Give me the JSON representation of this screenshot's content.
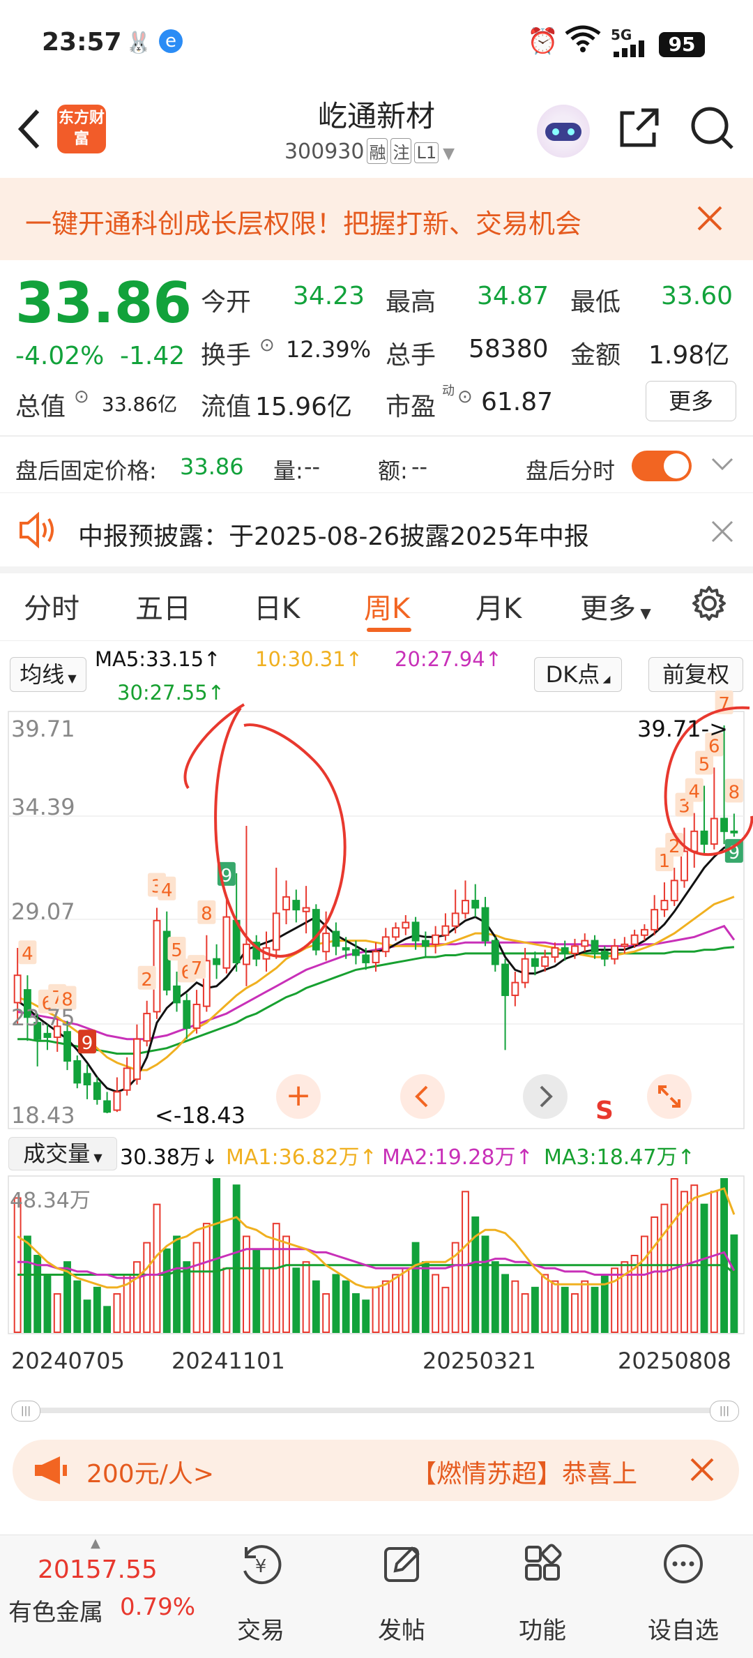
{
  "status_bar": {
    "time": "23:57",
    "network": "5G",
    "battery": "95"
  },
  "header": {
    "app_logo_text": "东方财富",
    "stock_name": "屹通新材",
    "stock_code": "300930",
    "tags": [
      "融",
      "注",
      "L1"
    ]
  },
  "banner": {
    "text": "一键开通科创成长层权限！把握打新、交易机会"
  },
  "quote": {
    "price": "33.86",
    "change_pct": "-4.02%",
    "change_amt": "-1.42",
    "open_label": "今开",
    "open": "34.23",
    "high_label": "最高",
    "high": "34.87",
    "low_label": "最低",
    "low": "33.60",
    "turnover_label": "换手",
    "turnover": "12.39%",
    "volume_label": "总手",
    "volume": "58380",
    "amount_label": "金额",
    "amount": "1.98亿",
    "mktcap_label": "总值",
    "mktcap": "33.86亿",
    "float_label": "流值",
    "float_cap": "15.96亿",
    "pe_label": "市盈",
    "pe_sup": "动",
    "pe": "61.87",
    "more_label": "更多"
  },
  "after_hours": {
    "label": "盘后固定价格:",
    "price": "33.86",
    "vol_label": "量:",
    "vol": "--",
    "amt_label": "额:",
    "amt": "--",
    "toggle_label": "盘后分时"
  },
  "notice": {
    "text": "中报预披露：于2025-08-26披露2025年中报"
  },
  "tabs": [
    "分时",
    "五日",
    "日K",
    "周K",
    "月K",
    "更多"
  ],
  "active_tab": "周K",
  "chart": {
    "indicator_label": "均线",
    "ma5": "MA5:33.15↑",
    "ma10": "10:30.31↑",
    "ma20": "20:27.94↑",
    "ma30": "30:27.55↑",
    "dk_label": "DK点",
    "adjust_label": "前复权",
    "y_labels": [
      "39.71",
      "34.39",
      "29.07",
      "23.75",
      "18.43"
    ],
    "max_marker": "39.71->",
    "min_marker": "<-18.43",
    "signal_s": "S",
    "colors": {
      "ma5": "#111111",
      "ma10": "#f0b020",
      "ma20": "#c830b8",
      "ma30": "#17a030",
      "up": "#e8382e",
      "down": "#12a23b"
    }
  },
  "volume_panel": {
    "label": "成交量",
    "vol": "30.38万↓",
    "ma1": "MA1:36.82万↑",
    "ma2": "MA2:19.28万↑",
    "ma3": "MA3:18.47万↑",
    "max_label": "48.34万",
    "dates": [
      "20240705",
      "20241101",
      "20250321",
      "20250808"
    ]
  },
  "promo": {
    "left": "200元/人>",
    "right": "【燃情苏超】恭喜上"
  },
  "bottom": {
    "index_value": "20157.55",
    "index_name": "有色金属",
    "index_pct": "0.79%",
    "nav": [
      "交易",
      "发帖",
      "功能",
      "设自选"
    ]
  },
  "chart_data": {
    "type": "candlestick",
    "period": "weekly",
    "ylim": [
      18.43,
      39.71
    ],
    "candles": [
      [
        24.5,
        26.0,
        23.3,
        27.5
      ],
      [
        25.2,
        23.7,
        22.4,
        26.0
      ],
      [
        23.4,
        22.5,
        21.0,
        23.9
      ],
      [
        22.8,
        22.6,
        21.9,
        23.3
      ],
      [
        22.6,
        23.2,
        21.8,
        23.6
      ],
      [
        22.9,
        21.3,
        20.8,
        23.5
      ],
      [
        21.3,
        20.1,
        19.8,
        21.6
      ],
      [
        20.6,
        20.0,
        19.2,
        21.1
      ],
      [
        20.1,
        19.2,
        18.9,
        20.4
      ],
      [
        19.1,
        18.5,
        18.43,
        19.6
      ],
      [
        18.6,
        19.6,
        18.5,
        20.4
      ],
      [
        19.7,
        20.9,
        19.4,
        21.5
      ],
      [
        20.3,
        22.5,
        20.0,
        23.3
      ],
      [
        22.4,
        23.9,
        22.1,
        24.6
      ],
      [
        24.0,
        29.0,
        23.6,
        29.7
      ],
      [
        28.4,
        25.2,
        24.9,
        29.5
      ],
      [
        25.4,
        24.5,
        24.0,
        26.2
      ],
      [
        24.6,
        23.1,
        22.5,
        25.0
      ],
      [
        23.1,
        24.4,
        22.8,
        25.2
      ],
      [
        24.3,
        26.8,
        24.0,
        28.2
      ],
      [
        26.9,
        26.6,
        25.8,
        27.7
      ],
      [
        26.4,
        29.2,
        26.1,
        30.3
      ],
      [
        29.0,
        26.7,
        26.2,
        31.6
      ],
      [
        26.6,
        27.7,
        25.4,
        34.2
      ],
      [
        27.8,
        26.9,
        26.5,
        28.2
      ],
      [
        26.9,
        27.5,
        26.2,
        28.4
      ],
      [
        27.4,
        29.4,
        26.9,
        31.9
      ],
      [
        29.6,
        30.3,
        28.8,
        31.2
      ],
      [
        30.1,
        29.6,
        28.9,
        30.7
      ],
      [
        29.5,
        29.7,
        28.3,
        30.9
      ],
      [
        29.6,
        27.4,
        27.1,
        29.9
      ],
      [
        27.3,
        28.3,
        26.8,
        29.5
      ],
      [
        28.4,
        27.6,
        27.1,
        28.9
      ],
      [
        27.5,
        27.4,
        26.9,
        28.1
      ],
      [
        27.4,
        27.1,
        26.6,
        27.9
      ],
      [
        27.1,
        26.7,
        26.3,
        27.5
      ],
      [
        26.7,
        27.3,
        26.2,
        27.8
      ],
      [
        27.3,
        28.1,
        27.0,
        28.6
      ],
      [
        28.1,
        28.6,
        27.9,
        28.9
      ],
      [
        28.6,
        28.9,
        28.2,
        29.3
      ],
      [
        28.9,
        27.9,
        27.4,
        29.2
      ],
      [
        27.9,
        27.6,
        27.0,
        28.4
      ],
      [
        27.7,
        28.2,
        27.2,
        28.7
      ],
      [
        28.2,
        28.7,
        27.9,
        29.4
      ],
      [
        28.7,
        29.4,
        28.3,
        30.7
      ],
      [
        29.4,
        30.1,
        29.1,
        31.2
      ],
      [
        30.1,
        29.7,
        29.2,
        31.0
      ],
      [
        29.7,
        27.9,
        27.6,
        30.3
      ],
      [
        27.9,
        26.6,
        26.2,
        28.1
      ],
      [
        26.6,
        24.9,
        21.9,
        26.9
      ],
      [
        24.9,
        25.6,
        24.3,
        26.2
      ],
      [
        25.6,
        26.9,
        25.3,
        27.5
      ],
      [
        26.9,
        26.5,
        26.0,
        27.3
      ],
      [
        26.5,
        27.0,
        26.2,
        27.4
      ],
      [
        27.0,
        27.5,
        26.7,
        27.8
      ],
      [
        27.5,
        27.2,
        26.8,
        27.9
      ],
      [
        27.2,
        27.6,
        26.9,
        28.0
      ],
      [
        27.6,
        27.9,
        27.3,
        28.3
      ],
      [
        27.9,
        27.3,
        26.9,
        28.2
      ],
      [
        27.3,
        26.9,
        26.5,
        27.6
      ],
      [
        26.9,
        27.6,
        26.6,
        28.0
      ],
      [
        27.6,
        27.7,
        27.2,
        28.1
      ],
      [
        27.7,
        28.2,
        27.5,
        28.5
      ],
      [
        28.2,
        28.5,
        27.9,
        28.8
      ],
      [
        28.5,
        29.6,
        28.2,
        30.4
      ],
      [
        29.6,
        30.1,
        29.2,
        31.1
      ],
      [
        30.1,
        31.2,
        29.8,
        31.9
      ],
      [
        31.2,
        32.8,
        30.8,
        34.1
      ],
      [
        32.8,
        33.9,
        31.9,
        34.9
      ],
      [
        33.9,
        33.2,
        32.7,
        36.4
      ],
      [
        33.2,
        34.6,
        32.9,
        37.4
      ],
      [
        34.6,
        33.9,
        33.2,
        39.71
      ],
      [
        33.9,
        33.86,
        33.6,
        34.87
      ]
    ],
    "ma_lines": {
      "ma5": [
        24.6,
        24.2,
        23.7,
        23.3,
        22.9,
        22.5,
        21.9,
        21.2,
        20.4,
        19.8,
        19.6,
        19.8,
        20.4,
        21.5,
        23.4,
        24.2,
        24.7,
        25.1,
        25.6,
        25.3,
        25.4,
        25.9,
        26.6,
        27.4,
        27.6,
        27.8,
        28.0,
        28.3,
        28.6,
        28.9,
        29.2,
        28.7,
        28.2,
        27.9,
        27.6,
        27.3,
        27.3,
        27.4,
        27.7,
        28.0,
        28.2,
        28.1,
        28.1,
        28.2,
        28.6,
        29.0,
        29.2,
        28.9,
        28.1,
        27.0,
        26.3,
        26.1,
        26.1,
        26.3,
        26.5,
        26.9,
        27.1,
        27.3,
        27.4,
        27.4,
        27.4,
        27.4,
        27.6,
        27.9,
        28.3,
        28.8,
        29.5,
        30.3,
        31.1,
        31.9,
        32.5,
        33.0,
        33.15
      ],
      "ma10": [
        24.8,
        24.6,
        24.3,
        24.0,
        23.7,
        23.3,
        22.9,
        22.5,
        22.0,
        21.5,
        21.2,
        21.0,
        20.8,
        20.8,
        21.1,
        21.5,
        22.0,
        22.6,
        23.1,
        23.4,
        23.9,
        24.4,
        24.9,
        25.3,
        25.6,
        26.0,
        26.4,
        26.9,
        27.2,
        27.5,
        27.7,
        27.8,
        27.9,
        27.9,
        27.9,
        27.9,
        27.8,
        27.7,
        27.6,
        27.6,
        27.6,
        27.6,
        27.6,
        27.7,
        27.9,
        28.1,
        28.3,
        28.3,
        28.2,
        28.0,
        27.9,
        27.8,
        27.7,
        27.6,
        27.5,
        27.3,
        27.2,
        27.1,
        27.0,
        27.0,
        27.1,
        27.2,
        27.3,
        27.5,
        27.7,
        28.0,
        28.3,
        28.7,
        29.1,
        29.5,
        29.9,
        30.1,
        30.31
      ],
      "ma20": [
        24.0,
        23.9,
        23.8,
        23.7,
        23.6,
        23.4,
        23.3,
        23.1,
        22.9,
        22.7,
        22.6,
        22.5,
        22.5,
        22.5,
        22.6,
        22.7,
        22.9,
        23.1,
        23.3,
        23.5,
        23.7,
        23.9,
        24.2,
        24.5,
        24.8,
        25.1,
        25.4,
        25.7,
        26.0,
        26.3,
        26.5,
        26.7,
        26.9,
        27.1,
        27.2,
        27.3,
        27.4,
        27.5,
        27.6,
        27.7,
        27.7,
        27.7,
        27.7,
        27.7,
        27.7,
        27.8,
        27.8,
        27.8,
        27.8,
        27.8,
        27.8,
        27.8,
        27.8,
        27.8,
        27.7,
        27.7,
        27.7,
        27.7,
        27.6,
        27.6,
        27.6,
        27.6,
        27.6,
        27.7,
        27.7,
        27.8,
        27.9,
        28.0,
        28.1,
        28.3,
        28.5,
        28.7,
        27.94
      ],
      "ma30": [
        22.5,
        22.5,
        22.4,
        22.4,
        22.3,
        22.2,
        22.1,
        22.0,
        21.9,
        21.8,
        21.7,
        21.7,
        21.7,
        21.8,
        21.9,
        22.0,
        22.2,
        22.4,
        22.6,
        22.8,
        23.0,
        23.2,
        23.4,
        23.7,
        23.9,
        24.2,
        24.5,
        24.8,
        25.0,
        25.3,
        25.5,
        25.7,
        25.9,
        26.1,
        26.3,
        26.4,
        26.5,
        26.6,
        26.7,
        26.8,
        26.9,
        27.0,
        27.0,
        27.1,
        27.1,
        27.2,
        27.2,
        27.2,
        27.2,
        27.2,
        27.2,
        27.2,
        27.2,
        27.2,
        27.2,
        27.2,
        27.2,
        27.2,
        27.2,
        27.2,
        27.2,
        27.2,
        27.2,
        27.2,
        27.2,
        27.2,
        27.3,
        27.3,
        27.3,
        27.4,
        27.4,
        27.5,
        27.55
      ]
    },
    "td_labels": [
      {
        "i": 1,
        "t": "4"
      },
      {
        "i": 3,
        "t": "6"
      },
      {
        "i": 4,
        "t": "7"
      },
      {
        "i": 5,
        "t": "8"
      },
      {
        "i": 7,
        "t": "9"
      },
      {
        "i": 14,
        "t": "3"
      },
      {
        "i": 13,
        "t": "2"
      },
      {
        "i": 15,
        "t": "4"
      },
      {
        "i": 16,
        "t": "5"
      },
      {
        "i": 17,
        "t": "6"
      },
      {
        "i": 18,
        "t": "7"
      },
      {
        "i": 19,
        "t": "8"
      },
      {
        "i": 21,
        "t": "9"
      },
      {
        "i": 65,
        "t": "1"
      },
      {
        "i": 66,
        "t": "2"
      },
      {
        "i": 67,
        "t": "3"
      },
      {
        "i": 68,
        "t": "4"
      },
      {
        "i": 69,
        "t": "5"
      },
      {
        "i": 70,
        "t": "6"
      },
      {
        "i": 71,
        "t": "7"
      },
      {
        "i": 72,
        "t": "8"
      },
      {
        "i": 72,
        "t": "9"
      }
    ],
    "volume": [
      42,
      30,
      24,
      18,
      12,
      22,
      16,
      10,
      14,
      8,
      12,
      18,
      22,
      28,
      40,
      26,
      30,
      22,
      28,
      34,
      48,
      20,
      46,
      30,
      26,
      20,
      34,
      30,
      20,
      22,
      16,
      12,
      18,
      16,
      12,
      10,
      14,
      16,
      18,
      20,
      28,
      22,
      18,
      14,
      28,
      44,
      36,
      30,
      22,
      18,
      16,
      12,
      14,
      18,
      16,
      14,
      12,
      16,
      14,
      18,
      20,
      22,
      24,
      30,
      36,
      40,
      48,
      44,
      46,
      40,
      44,
      48,
      30.38
    ],
    "vol_ma1": [
      30,
      28,
      25,
      22,
      20,
      19,
      17,
      16,
      15,
      14,
      14,
      15,
      17,
      20,
      24,
      27,
      29,
      30,
      32,
      33,
      34,
      35,
      36,
      33,
      32,
      30,
      29,
      28,
      27,
      26,
      24,
      21,
      19,
      17,
      15,
      14,
      14,
      15,
      17,
      19,
      21,
      22,
      22,
      22,
      24,
      27,
      30,
      32,
      32,
      31,
      28,
      24,
      20,
      17,
      15,
      15,
      15,
      15,
      15,
      15,
      16,
      18,
      20,
      23,
      27,
      31,
      35,
      39,
      42,
      43,
      44,
      45,
      36.82
    ],
    "vol_ma2": [
      22,
      22,
      21,
      21,
      20,
      20,
      19,
      19,
      18,
      18,
      17,
      17,
      17,
      18,
      18,
      19,
      20,
      20,
      21,
      22,
      23,
      24,
      25,
      26,
      26,
      26,
      26,
      26,
      26,
      26,
      25,
      25,
      24,
      23,
      22,
      21,
      20,
      20,
      20,
      20,
      20,
      20,
      20,
      20,
      21,
      21,
      22,
      22,
      23,
      23,
      22,
      22,
      21,
      20,
      20,
      19,
      19,
      19,
      18,
      18,
      18,
      18,
      18,
      18,
      19,
      19,
      20,
      21,
      22,
      23,
      24,
      25,
      19.28
    ],
    "vol_ma3": [
      18,
      18,
      18,
      18,
      18,
      18,
      18,
      18,
      18,
      18,
      18,
      18,
      18,
      18,
      18,
      18,
      19,
      19,
      19,
      19,
      19,
      20,
      20,
      20,
      20,
      20,
      20,
      21,
      21,
      21,
      21,
      21,
      21,
      21,
      21,
      21,
      21,
      21,
      21,
      21,
      21,
      21,
      21,
      21,
      21,
      21,
      21,
      21,
      21,
      21,
      21,
      21,
      21,
      21,
      21,
      21,
      21,
      21,
      21,
      21,
      21,
      21,
      21,
      21,
      21,
      21,
      21,
      21,
      21,
      21,
      21,
      21,
      18.47
    ]
  }
}
